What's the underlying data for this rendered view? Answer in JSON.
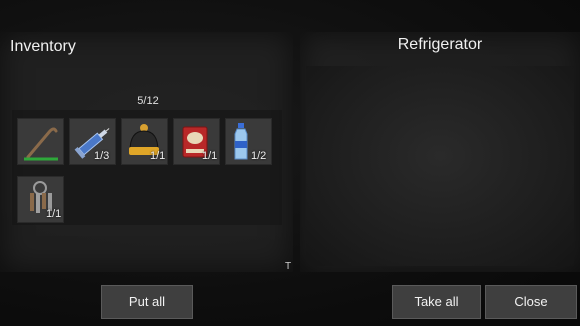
{
  "inventory": {
    "title": "Inventory",
    "capacity": "5/12",
    "items": [
      {
        "name": "crowbar",
        "icon": "crowbar-icon",
        "qty": ""
      },
      {
        "name": "syringe",
        "icon": "syringe-icon",
        "qty": "1/3"
      },
      {
        "name": "beanie hat",
        "icon": "beanie-icon",
        "qty": "1/1"
      },
      {
        "name": "canned food",
        "icon": "can-icon",
        "qty": "1/1"
      },
      {
        "name": "water bottle",
        "icon": "water-bottle-icon",
        "qty": "1/2"
      },
      {
        "name": "keys",
        "icon": "keys-icon",
        "qty": "1/1"
      }
    ],
    "put_all_label": "Put all"
  },
  "container": {
    "title": "Refrigerator",
    "take_all_label": "Take all",
    "close_label": "Close"
  },
  "cursor_glyph": "T",
  "colors": {
    "panel": "#242424",
    "slot": "#3a3a3a",
    "button": "#3f3f3f",
    "text": "#f0f0f0"
  }
}
